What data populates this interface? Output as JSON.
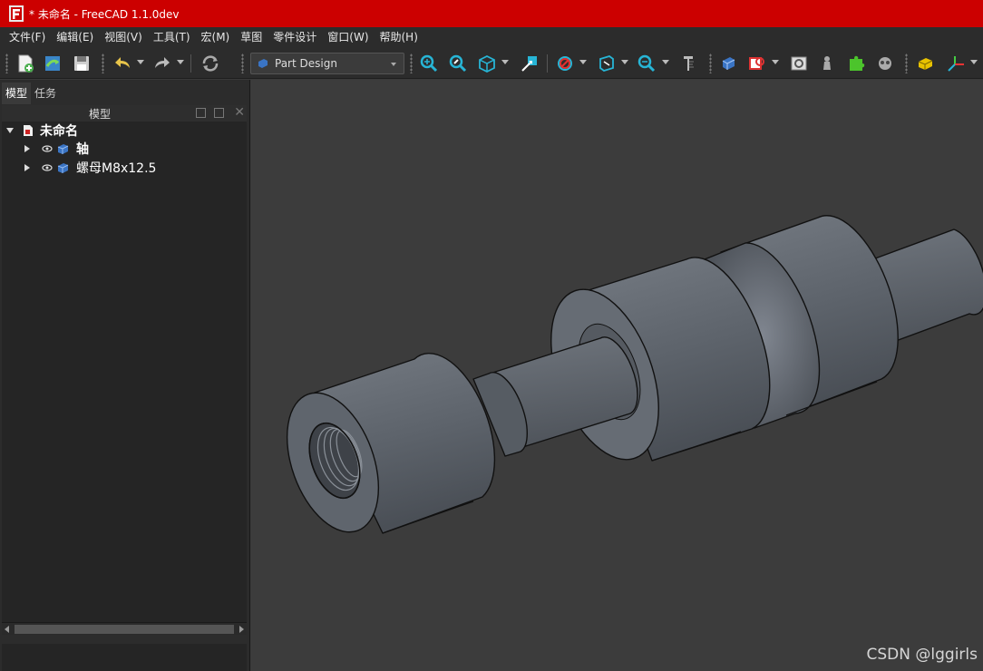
{
  "window": {
    "title": "* 未命名 - FreeCAD 1.1.0dev"
  },
  "menu": [
    {
      "label": "文件(F)"
    },
    {
      "label": "编辑(E)"
    },
    {
      "label": "视图(V)"
    },
    {
      "label": "工具(T)"
    },
    {
      "label": "宏(M)"
    },
    {
      "label": "草图"
    },
    {
      "label": "零件设计"
    },
    {
      "label": "窗口(W)"
    },
    {
      "label": "帮助(H)"
    }
  ],
  "toolbar": {
    "workbench": "Part Design",
    "icons": [
      "new-document-icon",
      "open-icon",
      "save-icon",
      "undo-icon",
      "redo-icon",
      "refresh-icon",
      "fit-all-icon",
      "fit-selection-icon",
      "view-cube-icon",
      "select-arrow-icon",
      "draw-style-icon",
      "stereo-icon",
      "zoom-box-icon",
      "measure-icon",
      "part-body-icon",
      "create-sketch-icon",
      "validate-sketch-icon",
      "pawn-icon",
      "puzzle-icon",
      "clone-icon",
      "create-part-icon",
      "axes-icon"
    ]
  },
  "combo_view": {
    "tabs": [
      {
        "label": "模型"
      },
      {
        "label": "任务"
      }
    ],
    "panel_title": "模型",
    "tree": {
      "document": "未命名",
      "items": [
        {
          "label": "轴"
        },
        {
          "label": "螺母M8x12.5"
        }
      ]
    }
  },
  "watermark": "CSDN @lggirls",
  "colors": {
    "titlebar": "#cc0000",
    "model": "#626870",
    "background": "#3c3c3c"
  }
}
